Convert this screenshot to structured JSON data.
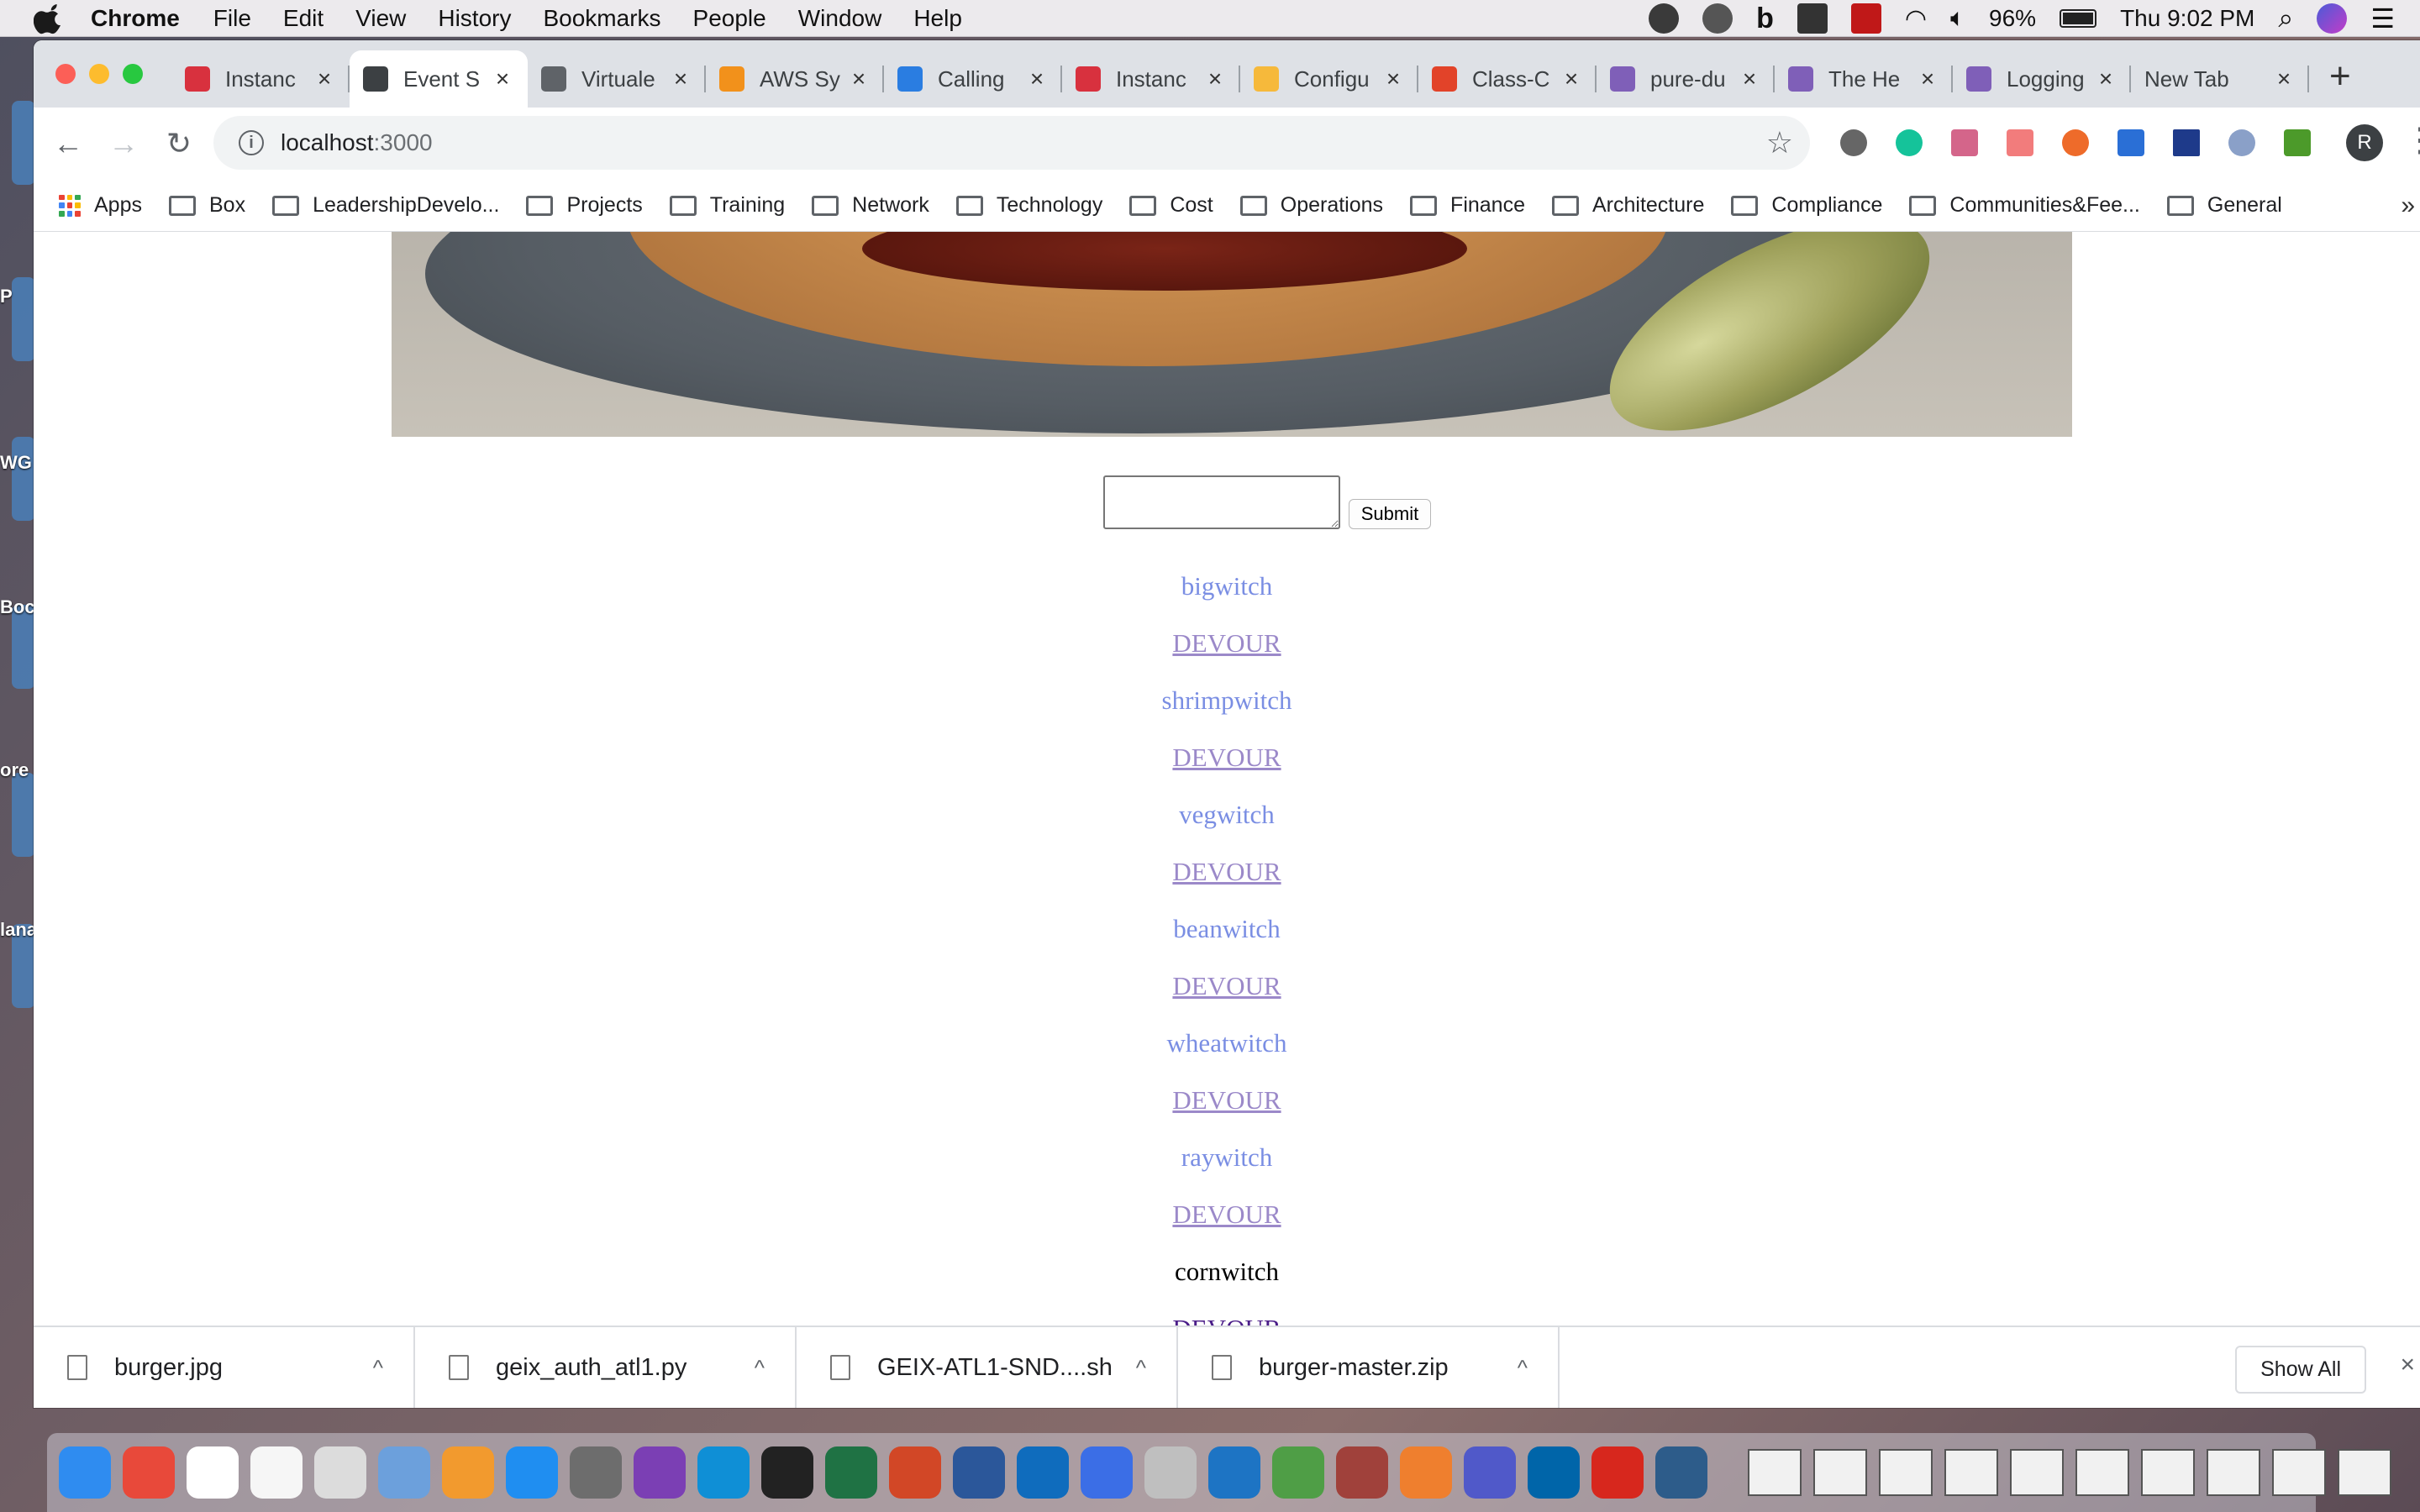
{
  "menubar": {
    "app_name": "Chrome",
    "items": [
      "File",
      "Edit",
      "View",
      "History",
      "Bookmarks",
      "People",
      "Window",
      "Help"
    ],
    "battery": "96%",
    "clock": "Thu 9:02 PM"
  },
  "desktop": {
    "labels": [
      "P",
      "WG",
      "Boc",
      "ore",
      "lana"
    ]
  },
  "browser": {
    "tabs": [
      {
        "title": "Instanc",
        "favicon_color": "#d8313e",
        "active": false
      },
      {
        "title": "Event S",
        "favicon_color": "#3c4043",
        "active": true
      },
      {
        "title": "Virtuale",
        "favicon_color": "#5f6368",
        "active": false
      },
      {
        "title": "AWS Sy",
        "favicon_color": "#f2911b",
        "active": false
      },
      {
        "title": "Calling",
        "favicon_color": "#2a7de1",
        "active": false
      },
      {
        "title": "Instanc",
        "favicon_color": "#d8313e",
        "active": false
      },
      {
        "title": "Configu",
        "favicon_color": "#f6b93b",
        "active": false
      },
      {
        "title": "Class-C",
        "favicon_color": "#e24329",
        "active": false
      },
      {
        "title": "pure-du",
        "favicon_color": "#7f5fb8",
        "active": false
      },
      {
        "title": "The He",
        "favicon_color": "#7f5fb8",
        "active": false
      },
      {
        "title": "Logging",
        "favicon_color": "#7f5fb8",
        "active": false
      },
      {
        "title": "New Tab",
        "favicon_color": "",
        "active": false
      }
    ],
    "new_tab_symbol": "+",
    "url_host": "localhost",
    "url_port": ":3000",
    "profile_initial": "R",
    "bookmarks": [
      "Apps",
      "Box",
      "LeadershipDevelo...",
      "Projects",
      "Training",
      "Network",
      "Technology",
      "Cost",
      "Operations",
      "Finance",
      "Architecture",
      "Compliance",
      "Communities&Fee...",
      "General"
    ],
    "bookmarks_overflow": "»"
  },
  "page": {
    "form": {
      "input_value": "",
      "submit_label": "Submit"
    },
    "burgers": [
      {
        "name": "bigwitch",
        "action": "DEVOUR",
        "devoured": false
      },
      {
        "name": "shrimpwitch",
        "action": "DEVOUR",
        "devoured": false
      },
      {
        "name": "vegwitch",
        "action": "DEVOUR",
        "devoured": false
      },
      {
        "name": "beanwitch",
        "action": "DEVOUR",
        "devoured": false
      },
      {
        "name": "wheatwitch",
        "action": "DEVOUR",
        "devoured": false
      },
      {
        "name": "raywitch",
        "action": "DEVOUR",
        "devoured": false
      },
      {
        "name": "cornwitch",
        "action": "DEVOUR",
        "devoured": true
      }
    ]
  },
  "downloads": {
    "items": [
      "burger.jpg",
      "geix_auth_atl1.py",
      "GEIX-ATL1-SND....sh",
      "burger-master.zip"
    ],
    "show_all_label": "Show All"
  },
  "dock": {
    "app_colors": [
      "#2f8cf0",
      "#e8493a",
      "#ffffff",
      "#f6f6f6",
      "#dcdcdc",
      "#6ca0dc",
      "#f29a2e",
      "#1f8ef1",
      "#6d6d6d",
      "#7b3fb4",
      "#0f8fd6",
      "#222222",
      "#1f7244",
      "#d24726",
      "#2b579a",
      "#0f6cbd",
      "#3b6ee6",
      "#bfbfbf",
      "#1d74c4",
      "#4f9e46",
      "#a0413b",
      "#ef7f2e",
      "#5059c9",
      "#0065a9",
      "#d7271d",
      "#2d5c8a"
    ],
    "thumb_count": 10
  }
}
